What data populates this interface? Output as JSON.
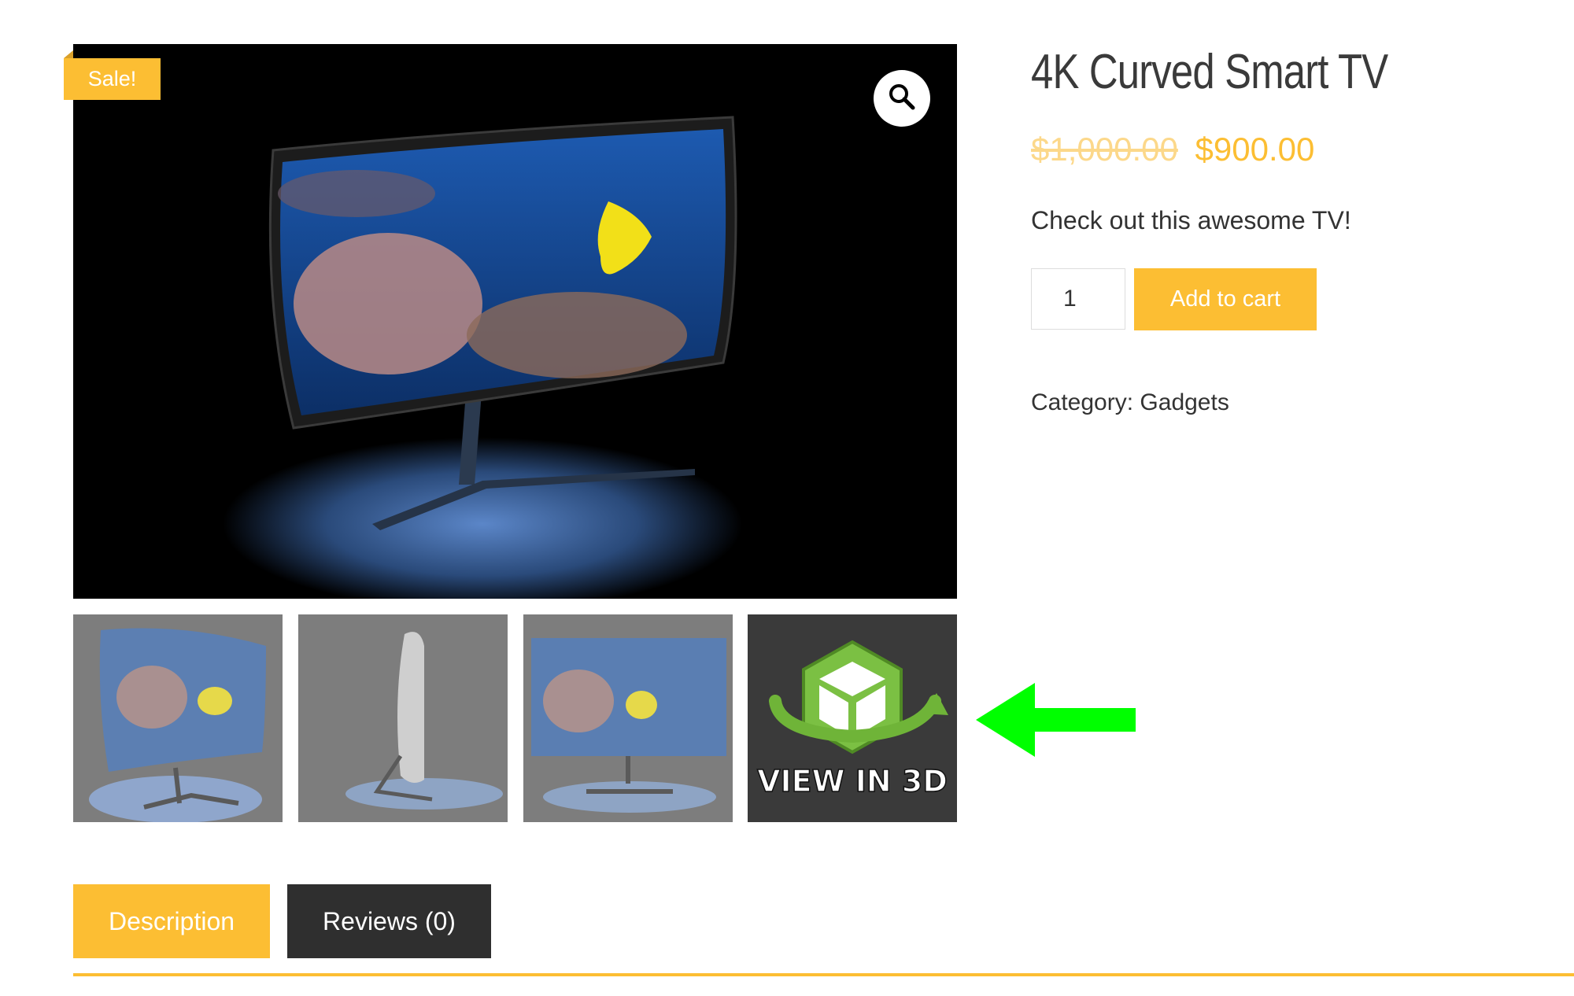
{
  "product": {
    "title": "4K Curved Smart TV",
    "price_old": "$1,000.00",
    "price_new": "$900.00",
    "short_description": "Check out this awesome TV!",
    "quantity": "1",
    "add_to_cart_label": "Add to cart",
    "category_label": "Category:",
    "category_value": "Gadgets",
    "sale_badge": "Sale!"
  },
  "gallery": {
    "zoom_icon": "magnifier-icon",
    "thumbnails": [
      {
        "name": "tv-front-angle"
      },
      {
        "name": "tv-side-profile"
      },
      {
        "name": "tv-front"
      },
      {
        "name": "view-in-3d",
        "label": "VIEW IN 3D"
      }
    ]
  },
  "annotation": {
    "icon": "green-arrow-left-icon",
    "color": "#00ff00"
  },
  "tabs": [
    {
      "label": "Description",
      "active": true
    },
    {
      "label": "Reviews (0)",
      "active": false
    }
  ],
  "colors": {
    "accent": "#fcbe33",
    "dark_tab": "#2f2f2f",
    "text": "#333333"
  }
}
